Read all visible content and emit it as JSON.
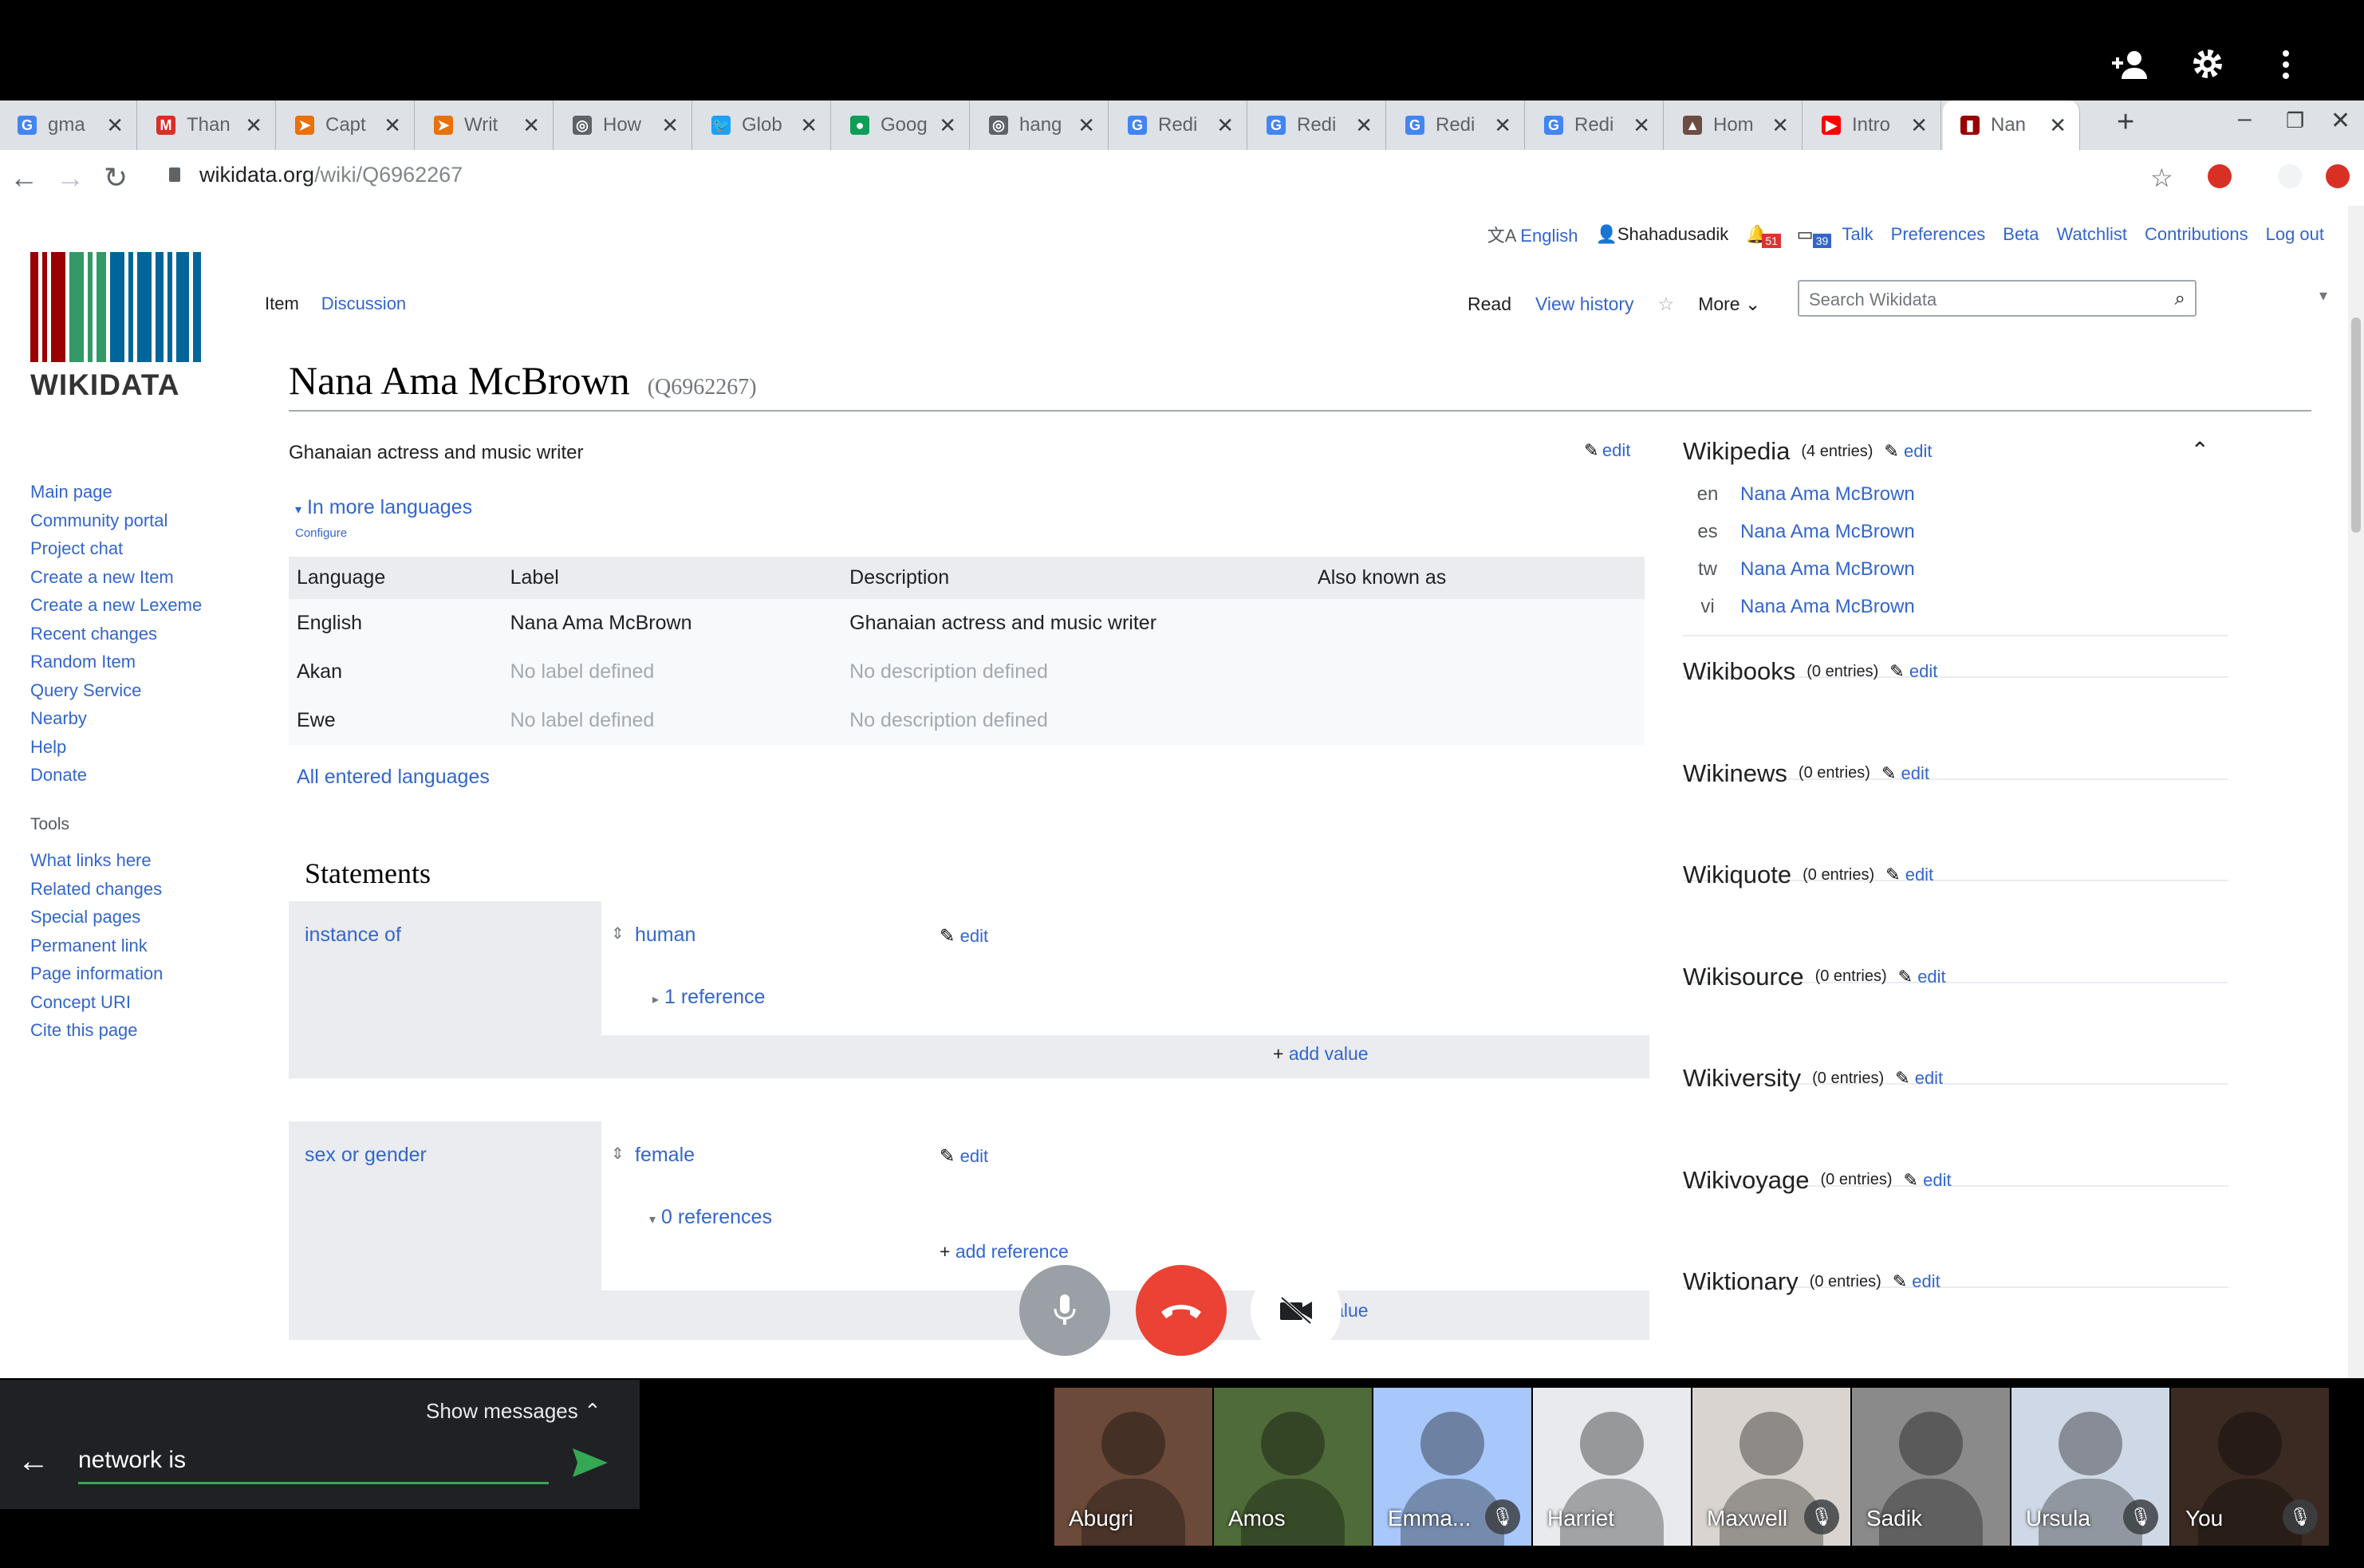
{
  "tabs": [
    {
      "label": "gma",
      "fav": "G",
      "color": "#4285f4"
    },
    {
      "label": "Than",
      "fav": "M",
      "color": "#d93025"
    },
    {
      "label": "Capt",
      "fav": "➤",
      "color": "#e8710a"
    },
    {
      "label": "Writ",
      "fav": "➤",
      "color": "#e8710a"
    },
    {
      "label": "How",
      "fav": "◎",
      "color": "#5f6368"
    },
    {
      "label": "Glob",
      "fav": "🐦",
      "color": "#1da1f2"
    },
    {
      "label": "Goog",
      "fav": "●",
      "color": "#0f9d58"
    },
    {
      "label": "hang",
      "fav": "◎",
      "color": "#5f6368"
    },
    {
      "label": "Redi",
      "fav": "G",
      "color": "#4285f4"
    },
    {
      "label": "Redi",
      "fav": "G",
      "color": "#4285f4"
    },
    {
      "label": "Redi",
      "fav": "G",
      "color": "#4285f4"
    },
    {
      "label": "Redi",
      "fav": "G",
      "color": "#4285f4"
    },
    {
      "label": "Hom",
      "fav": "▲",
      "color": "#6d4c41"
    },
    {
      "label": "Intro",
      "fav": "▶",
      "color": "#ff0000"
    },
    {
      "label": "Nan",
      "fav": "▮",
      "color": "#990000"
    }
  ],
  "address": {
    "domain": "wikidata.org",
    "path": "/wiki/Q6962267"
  },
  "logo_text": "WIKIDATA",
  "sidebar": {
    "nav": [
      "Main page",
      "Community portal",
      "Project chat",
      "Create a new Item",
      "Create a new Lexeme",
      "Recent changes",
      "Random Item",
      "Query Service",
      "Nearby",
      "Help",
      "Donate"
    ],
    "tools_heading": "Tools",
    "tools": [
      "What links here",
      "Related changes",
      "Special pages",
      "Permanent link",
      "Page information",
      "Concept URI",
      "Cite this page"
    ]
  },
  "personal": {
    "lang": "English",
    "user": "Shahadusadik",
    "notif1": "51",
    "notif2": "39",
    "links": [
      "Talk",
      "Preferences",
      "Beta",
      "Watchlist",
      "Contributions",
      "Log out"
    ]
  },
  "page_tabs": {
    "item": "Item",
    "discussion": "Discussion",
    "read": "Read",
    "history": "View history",
    "more": "More"
  },
  "search_placeholder": "Search Wikidata",
  "entity": {
    "label": "Nana Ama McBrown",
    "qid": "(Q6962267)",
    "description": "Ghanaian actress and music writer",
    "edit": "edit"
  },
  "languages": {
    "toggle": "In more languages",
    "configure": "Configure",
    "headers": [
      "Language",
      "Label",
      "Description",
      "Also known as"
    ],
    "rows": [
      {
        "lang": "English",
        "label": "Nana Ama McBrown",
        "desc": "Ghanaian actress and music writer"
      },
      {
        "lang": "Akan",
        "label": "No label defined",
        "desc": "No description defined"
      },
      {
        "lang": "Ewe",
        "label": "No label defined",
        "desc": "No description defined"
      }
    ],
    "all": "All entered languages"
  },
  "statements": {
    "heading": "Statements",
    "items": [
      {
        "prop": "instance of",
        "value": "human",
        "refs": "1 reference",
        "edit": "edit",
        "add": "add value"
      },
      {
        "prop": "sex or gender",
        "value": "female",
        "refs": "0 references",
        "edit": "edit",
        "add_ref": "add reference",
        "add": "add value"
      }
    ]
  },
  "sitelinks": {
    "wikipedia": {
      "title": "Wikipedia",
      "count": "(4 entries)",
      "edit": "edit",
      "links": [
        {
          "code": "en",
          "title": "Nana Ama McBrown"
        },
        {
          "code": "es",
          "title": "Nana Ama McBrown"
        },
        {
          "code": "tw",
          "title": "Nana Ama McBrown"
        },
        {
          "code": "vi",
          "title": "Nana Ama McBrown"
        }
      ]
    },
    "others": [
      {
        "title": "Wikibooks",
        "count": "(0 entries)",
        "edit": "edit"
      },
      {
        "title": "Wikinews",
        "count": "(0 entries)",
        "edit": "edit"
      },
      {
        "title": "Wikiquote",
        "count": "(0 entries)",
        "edit": "edit"
      },
      {
        "title": "Wikisource",
        "count": "(0 entries)",
        "edit": "edit"
      },
      {
        "title": "Wikiversity",
        "count": "(0 entries)",
        "edit": "edit"
      },
      {
        "title": "Wikivoyage",
        "count": "(0 entries)",
        "edit": "edit"
      },
      {
        "title": "Wiktionary",
        "count": "(0 entries)",
        "edit": "edit"
      }
    ]
  },
  "meet": {
    "show_messages": "Show messages",
    "chat_input": "network is",
    "participants": [
      {
        "name": "Abugri",
        "muted": false,
        "bg": "#6b4a3a"
      },
      {
        "name": "Amos",
        "muted": false,
        "bg": "#4f6b3a"
      },
      {
        "name": "Emma...",
        "muted": true,
        "bg": "#a8c7fa"
      },
      {
        "name": "Harriet",
        "muted": false,
        "bg": "#e8eaed"
      },
      {
        "name": "Maxwell",
        "muted": true,
        "bg": "#d9d4cf"
      },
      {
        "name": "Sadik",
        "muted": false,
        "bg": "#8a8a8a"
      },
      {
        "name": "Ursula",
        "muted": true,
        "bg": "#cfd8e6"
      },
      {
        "name": "You",
        "muted": true,
        "bg": "#3b2a22"
      }
    ]
  }
}
